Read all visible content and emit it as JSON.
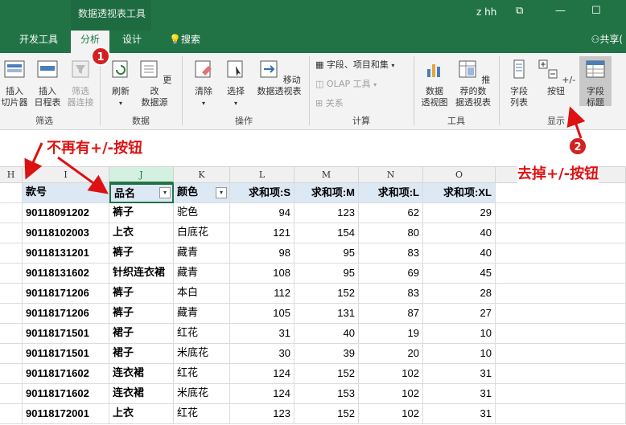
{
  "titlebar": {
    "context_label": "数据透视表工具",
    "user": "z hh",
    "min": "—",
    "restore": "⧉",
    "max": "☐"
  },
  "tabs": [
    {
      "label": "开发工具"
    },
    {
      "label": "分析"
    },
    {
      "label": "设计"
    },
    {
      "label": "搜索"
    }
  ],
  "share_label": "共享(",
  "ribbon": {
    "insert_slicer": "插入\n切片器",
    "insert_timeline": "插入\n日程表",
    "filter_conn": "筛选\n器连接",
    "group_filter": "筛选",
    "refresh": "刷新",
    "change_source": "更改\n数据源",
    "group_data": "数据",
    "clear": "清除",
    "select": "选择",
    "move": "移动\n数据透视表",
    "group_ops": "操作",
    "fields_items": "字段、项目和集",
    "olap": "OLAP 工具",
    "relations": "关系",
    "group_calc": "计算",
    "pivot_chart": "数据\n透视图",
    "recommended": "推荐的数\n据透视表",
    "group_tools": "工具",
    "field_list": "字段\n列表",
    "plus_minus": "+/- 按钮",
    "field_headers": "字段\n标题",
    "group_show": "显示"
  },
  "columns": [
    "H",
    "I",
    "J",
    "K",
    "L",
    "M",
    "N",
    "O"
  ],
  "table": {
    "headers": [
      "款号",
      "品名",
      "颜色",
      "求和项:S",
      "求和项:M",
      "求和项:L",
      "求和项:XL"
    ],
    "rows": [
      [
        "90118091202",
        "裤子",
        "驼色",
        "94",
        "123",
        "62",
        "29"
      ],
      [
        "90118102003",
        "上衣",
        "白底花",
        "121",
        "154",
        "80",
        "40"
      ],
      [
        "90118131201",
        "裤子",
        "藏青",
        "98",
        "95",
        "83",
        "40"
      ],
      [
        "90118131602",
        "针织连衣裙",
        "藏青",
        "108",
        "95",
        "69",
        "45"
      ],
      [
        "90118171206",
        "裤子",
        "本白",
        "112",
        "152",
        "83",
        "28"
      ],
      [
        "90118171206",
        "裤子",
        "藏青",
        "105",
        "131",
        "87",
        "27"
      ],
      [
        "90118171501",
        "裙子",
        "红花",
        "31",
        "40",
        "19",
        "10"
      ],
      [
        "90118171501",
        "裙子",
        "米底花",
        "30",
        "39",
        "20",
        "10"
      ],
      [
        "90118171602",
        "连衣裙",
        "红花",
        "124",
        "152",
        "102",
        "31"
      ],
      [
        "90118171602",
        "连衣裙",
        "米底花",
        "124",
        "153",
        "102",
        "31"
      ],
      [
        "90118172001",
        "上衣",
        "红花",
        "123",
        "152",
        "102",
        "31"
      ]
    ]
  },
  "annotations": {
    "badge1": "1",
    "badge2": "2",
    "left_note": "不再有+/-按钮",
    "right_note": "去掉+/-按钮"
  },
  "colors": {
    "excel_green": "#217346",
    "annotation_red": "#d11111",
    "header_blue": "#dde8f5"
  }
}
